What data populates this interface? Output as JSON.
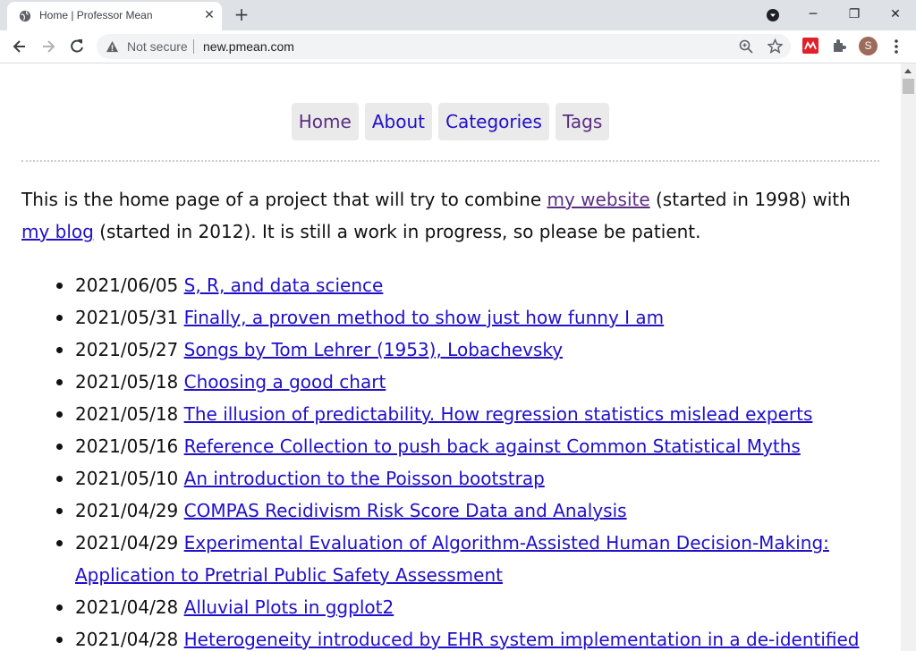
{
  "tab": {
    "title": "Home | Professor Mean",
    "close": "✕"
  },
  "new_tab": "+",
  "window_controls": {
    "minimize": "─",
    "restore": "❐",
    "close": "✕"
  },
  "omnibox": {
    "security": "Not secure",
    "url": "new.pmean.com"
  },
  "profile": {
    "initial": "S"
  },
  "nav": {
    "home": "Home",
    "about": "About",
    "categories": "Categories",
    "tags": "Tags",
    "home_color": "#5a2d82",
    "link_color": "#2010c8"
  },
  "intro": {
    "text1": "This is the home page of a project that will try to combine ",
    "link1": "my website",
    "text2": " (started in 1998) with ",
    "link2": "my blog",
    "text3": " (started in 2012). It is still a work in progress, so please be patient."
  },
  "posts": [
    {
      "date": "2021/06/05",
      "title": "S, R, and data science"
    },
    {
      "date": "2021/05/31",
      "title": "Finally, a proven method to show just how funny I am"
    },
    {
      "date": "2021/05/27",
      "title": "Songs by Tom Lehrer (1953), Lobachevsky"
    },
    {
      "date": "2021/05/18",
      "title": "Choosing a good chart"
    },
    {
      "date": "2021/05/18",
      "title": "The illusion of predictability. How regression statistics mislead experts"
    },
    {
      "date": "2021/05/16",
      "title": "Reference Collection to push back against Common Statistical Myths"
    },
    {
      "date": "2021/05/10",
      "title": "An introduction to the Poisson bootstrap"
    },
    {
      "date": "2021/04/29",
      "title": "COMPAS Recidivism Risk Score Data and Analysis"
    },
    {
      "date": "2021/04/29",
      "title": "Experimental Evaluation of Algorithm-Assisted Human Decision-Making: Application to Pretrial Public Safety Assessment"
    },
    {
      "date": "2021/04/28",
      "title": "Alluvial Plots in ggplot2"
    },
    {
      "date": "2021/04/28",
      "title": "Heterogeneity introduced by EHR system implementation in a de-identified"
    }
  ]
}
